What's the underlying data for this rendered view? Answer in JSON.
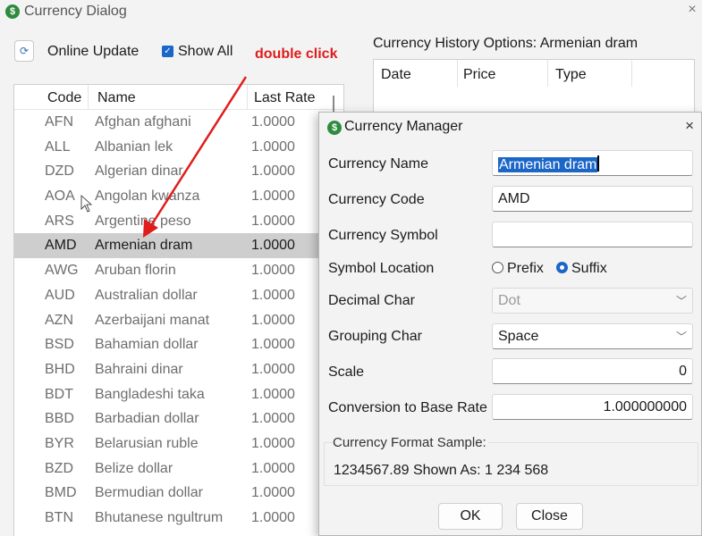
{
  "window": {
    "title": "Currency Dialog",
    "close_glyph": "×",
    "icon": "dollar-coin-icon"
  },
  "toolbar": {
    "online_update_label": "Online Update",
    "show_all_label": "Show All",
    "show_all_checked": true
  },
  "annotation": {
    "text": "double click",
    "color": "#e01c1c"
  },
  "list": {
    "columns": [
      "Code",
      "Name",
      "Last Rate"
    ],
    "selected_code": "AMD",
    "rows": [
      {
        "code": "AFN",
        "name": "Afghan afghani",
        "rate": "1.0000"
      },
      {
        "code": "ALL",
        "name": "Albanian lek",
        "rate": "1.0000"
      },
      {
        "code": "DZD",
        "name": "Algerian dinar",
        "rate": "1.0000"
      },
      {
        "code": "AOA",
        "name": "Angolan kwanza",
        "rate": "1.0000"
      },
      {
        "code": "ARS",
        "name": "Argentine peso",
        "rate": "1.0000"
      },
      {
        "code": "AMD",
        "name": "Armenian dram",
        "rate": "1.0000"
      },
      {
        "code": "AWG",
        "name": "Aruban florin",
        "rate": "1.0000"
      },
      {
        "code": "AUD",
        "name": "Australian dollar",
        "rate": "1.0000"
      },
      {
        "code": "AZN",
        "name": "Azerbaijani manat",
        "rate": "1.0000"
      },
      {
        "code": "BSD",
        "name": "Bahamian dollar",
        "rate": "1.0000"
      },
      {
        "code": "BHD",
        "name": "Bahraini dinar",
        "rate": "1.0000"
      },
      {
        "code": "BDT",
        "name": "Bangladeshi taka",
        "rate": "1.0000"
      },
      {
        "code": "BBD",
        "name": "Barbadian dollar",
        "rate": "1.0000"
      },
      {
        "code": "BYR",
        "name": "Belarusian ruble",
        "rate": "1.0000"
      },
      {
        "code": "BZD",
        "name": "Belize dollar",
        "rate": "1.0000"
      },
      {
        "code": "BMD",
        "name": "Bermudian dollar",
        "rate": "1.0000"
      },
      {
        "code": "BTN",
        "name": "Bhutanese ngultrum",
        "rate": "1.0000"
      }
    ]
  },
  "history": {
    "title": "Currency History Options: Armenian dram",
    "columns": [
      "Date",
      "Price",
      "Type"
    ]
  },
  "dialog": {
    "title": "Currency Manager",
    "close_glyph": "×",
    "currency_name_label": "Currency Name",
    "currency_name_value": "Armenian dram",
    "currency_code_label": "Currency Code",
    "currency_code_value": "AMD",
    "currency_symbol_label": "Currency Symbol",
    "currency_symbol_value": "",
    "symbol_location_label": "Symbol Location",
    "prefix_label": "Prefix",
    "suffix_label": "Suffix",
    "symbol_location_selected": "Suffix",
    "decimal_char_label": "Decimal Char",
    "decimal_char_value": "Dot",
    "grouping_char_label": "Grouping Char",
    "grouping_char_value": "Space",
    "scale_label": "Scale",
    "scale_value": "0",
    "conversion_label": "Conversion to Base Rate",
    "conversion_value": "1.000000000",
    "sample_title": "Currency Format Sample:",
    "sample_text": "1234567.89 Shown As: 1 234 568",
    "ok_label": "OK",
    "close_label": "Close"
  },
  "colors": {
    "accent": "#1a66c9",
    "selection_row": "#cecece",
    "annotation": "#e01c1c",
    "icon_green": "#2e8b3e"
  }
}
